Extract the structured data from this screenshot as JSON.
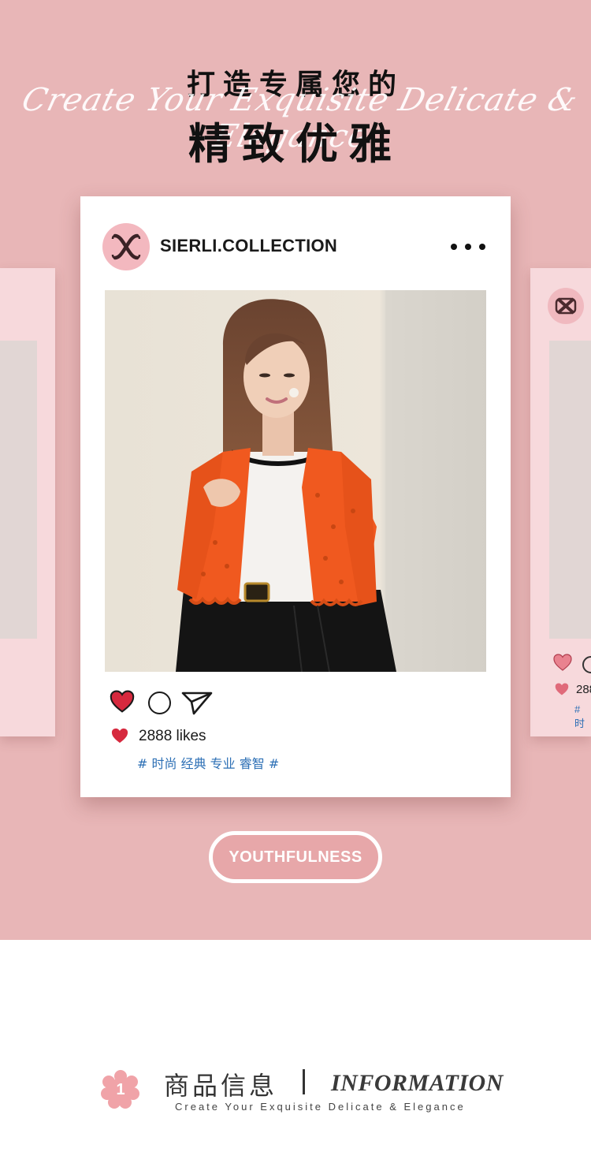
{
  "header": {
    "title_small": "打造专属您的",
    "script_text": "Create Your Exquisite Delicate & Elegance",
    "title_large": "精致优雅"
  },
  "post": {
    "username": "SIERLI.COLLECTION",
    "avatar_icon": "sierli-monogram-logo",
    "likes_text": "2888 likes",
    "hashtags": "# 时尚 经典 专业 睿智 #",
    "photo_alt": "model in orange cardigan"
  },
  "side_card_right": {
    "likes_text": "288",
    "tag_text": "# 时"
  },
  "cta": {
    "label": "YOUTHFULNESS"
  },
  "section": {
    "number": "1",
    "title_cn": "商品信息",
    "title_en": "INFORMATION",
    "subtitle": "Create Your Exquisite Delicate & Elegance"
  },
  "colors": {
    "banner_bg": "#e8b6b7",
    "heart_red": "#d6293e",
    "hashtag_blue": "#2c6fb5",
    "side_card_bg": "#f7d9dc"
  }
}
